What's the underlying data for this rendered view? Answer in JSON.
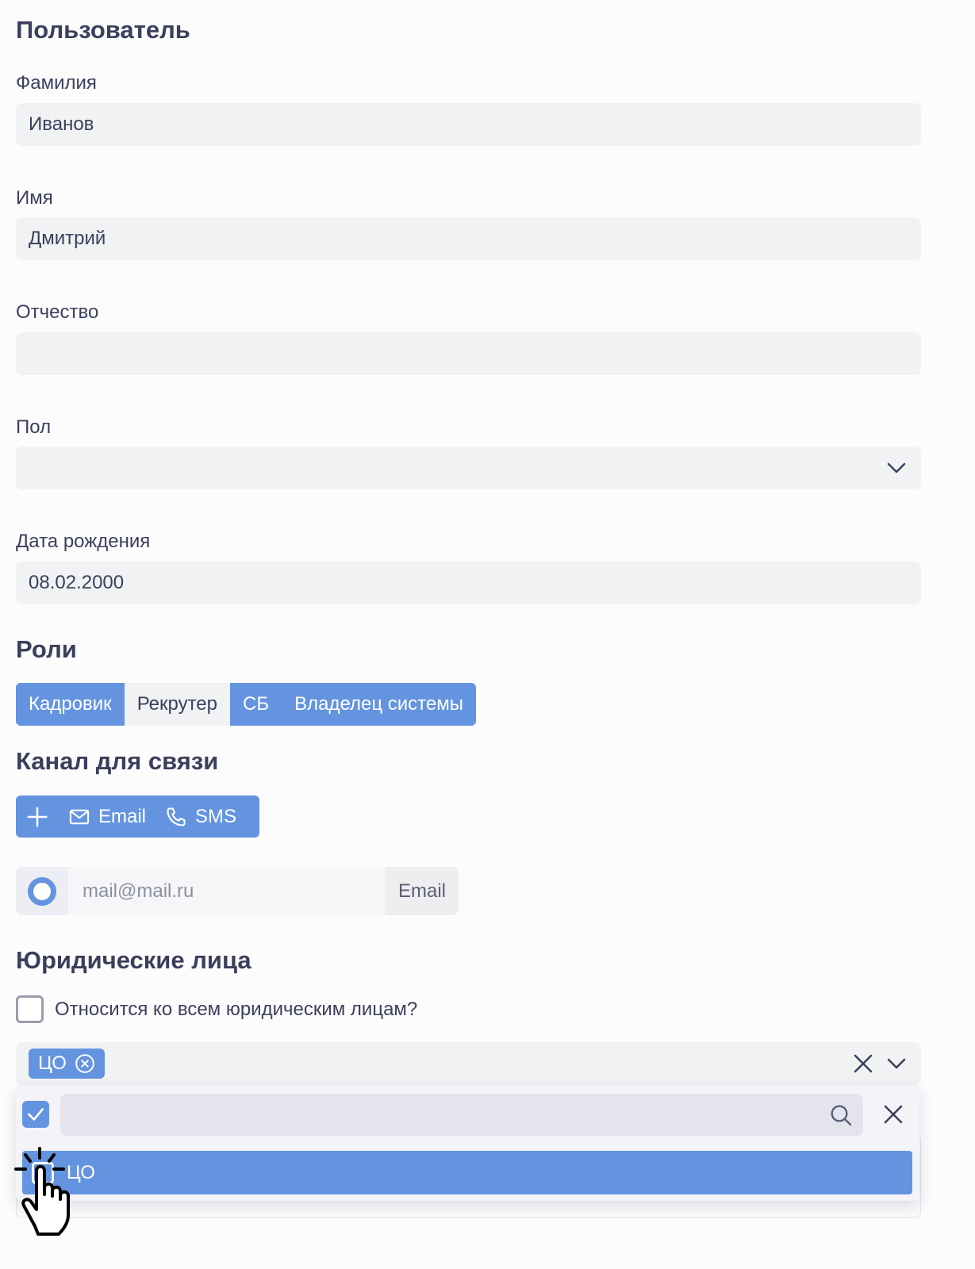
{
  "user": {
    "title": "Пользователь",
    "last_name": {
      "label": "Фамилия",
      "value": "Иванов"
    },
    "first_name": {
      "label": "Имя",
      "value": "Дмитрий"
    },
    "patronymic": {
      "label": "Отчество",
      "value": ""
    },
    "gender": {
      "label": "Пол",
      "value": "",
      "icon": "chevron-down-icon"
    },
    "birth_date": {
      "label": "Дата рождения",
      "value": "08.02.2000"
    }
  },
  "roles": {
    "title": "Роли",
    "items": [
      {
        "label": "Кадровик",
        "selected": true
      },
      {
        "label": "Рекрутер",
        "selected": false
      },
      {
        "label": "СБ",
        "selected": true
      },
      {
        "label": "Владелец системы",
        "selected": true
      }
    ]
  },
  "channel": {
    "title": "Канал для связи",
    "add_icon": "plus-icon",
    "email_label": "Email",
    "email_icon": "mail-icon",
    "sms_label": "SMS",
    "sms_icon": "phone-icon",
    "contact": {
      "value": "mail@mail.ru",
      "type": "Email"
    }
  },
  "legal": {
    "title": "Юридические лица",
    "all_checkbox_label": "Относится ко всем юридическим лицам?",
    "selected_tags": [
      "ЦО"
    ],
    "dropdown": {
      "search_value": "",
      "options": [
        {
          "label": "ЦО",
          "selected": true
        }
      ]
    }
  },
  "colors": {
    "accent": "#6494e0",
    "text": "#3b3f5c",
    "field_bg": "#f1f2f4"
  }
}
